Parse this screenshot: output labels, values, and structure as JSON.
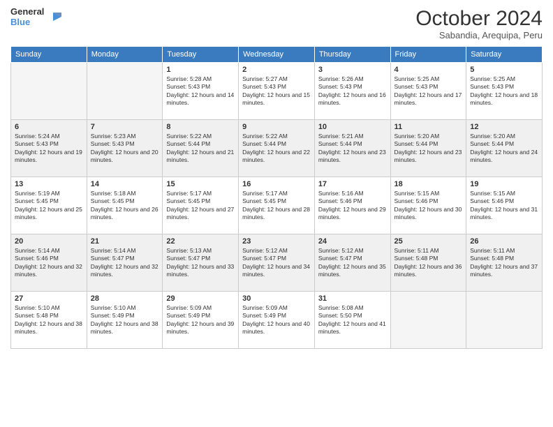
{
  "logo": {
    "line1": "General",
    "line2": "Blue"
  },
  "title": "October 2024",
  "location": "Sabandia, Arequipa, Peru",
  "days_of_week": [
    "Sunday",
    "Monday",
    "Tuesday",
    "Wednesday",
    "Thursday",
    "Friday",
    "Saturday"
  ],
  "weeks": [
    [
      {
        "day": "",
        "info": ""
      },
      {
        "day": "",
        "info": ""
      },
      {
        "day": "1",
        "info": "Sunrise: 5:28 AM\nSunset: 5:43 PM\nDaylight: 12 hours and 14 minutes."
      },
      {
        "day": "2",
        "info": "Sunrise: 5:27 AM\nSunset: 5:43 PM\nDaylight: 12 hours and 15 minutes."
      },
      {
        "day": "3",
        "info": "Sunrise: 5:26 AM\nSunset: 5:43 PM\nDaylight: 12 hours and 16 minutes."
      },
      {
        "day": "4",
        "info": "Sunrise: 5:25 AM\nSunset: 5:43 PM\nDaylight: 12 hours and 17 minutes."
      },
      {
        "day": "5",
        "info": "Sunrise: 5:25 AM\nSunset: 5:43 PM\nDaylight: 12 hours and 18 minutes."
      }
    ],
    [
      {
        "day": "6",
        "info": "Sunrise: 5:24 AM\nSunset: 5:43 PM\nDaylight: 12 hours and 19 minutes."
      },
      {
        "day": "7",
        "info": "Sunrise: 5:23 AM\nSunset: 5:43 PM\nDaylight: 12 hours and 20 minutes."
      },
      {
        "day": "8",
        "info": "Sunrise: 5:22 AM\nSunset: 5:44 PM\nDaylight: 12 hours and 21 minutes."
      },
      {
        "day": "9",
        "info": "Sunrise: 5:22 AM\nSunset: 5:44 PM\nDaylight: 12 hours and 22 minutes."
      },
      {
        "day": "10",
        "info": "Sunrise: 5:21 AM\nSunset: 5:44 PM\nDaylight: 12 hours and 23 minutes."
      },
      {
        "day": "11",
        "info": "Sunrise: 5:20 AM\nSunset: 5:44 PM\nDaylight: 12 hours and 23 minutes."
      },
      {
        "day": "12",
        "info": "Sunrise: 5:20 AM\nSunset: 5:44 PM\nDaylight: 12 hours and 24 minutes."
      }
    ],
    [
      {
        "day": "13",
        "info": "Sunrise: 5:19 AM\nSunset: 5:45 PM\nDaylight: 12 hours and 25 minutes."
      },
      {
        "day": "14",
        "info": "Sunrise: 5:18 AM\nSunset: 5:45 PM\nDaylight: 12 hours and 26 minutes."
      },
      {
        "day": "15",
        "info": "Sunrise: 5:17 AM\nSunset: 5:45 PM\nDaylight: 12 hours and 27 minutes."
      },
      {
        "day": "16",
        "info": "Sunrise: 5:17 AM\nSunset: 5:45 PM\nDaylight: 12 hours and 28 minutes."
      },
      {
        "day": "17",
        "info": "Sunrise: 5:16 AM\nSunset: 5:46 PM\nDaylight: 12 hours and 29 minutes."
      },
      {
        "day": "18",
        "info": "Sunrise: 5:15 AM\nSunset: 5:46 PM\nDaylight: 12 hours and 30 minutes."
      },
      {
        "day": "19",
        "info": "Sunrise: 5:15 AM\nSunset: 5:46 PM\nDaylight: 12 hours and 31 minutes."
      }
    ],
    [
      {
        "day": "20",
        "info": "Sunrise: 5:14 AM\nSunset: 5:46 PM\nDaylight: 12 hours and 32 minutes."
      },
      {
        "day": "21",
        "info": "Sunrise: 5:14 AM\nSunset: 5:47 PM\nDaylight: 12 hours and 32 minutes."
      },
      {
        "day": "22",
        "info": "Sunrise: 5:13 AM\nSunset: 5:47 PM\nDaylight: 12 hours and 33 minutes."
      },
      {
        "day": "23",
        "info": "Sunrise: 5:12 AM\nSunset: 5:47 PM\nDaylight: 12 hours and 34 minutes."
      },
      {
        "day": "24",
        "info": "Sunrise: 5:12 AM\nSunset: 5:47 PM\nDaylight: 12 hours and 35 minutes."
      },
      {
        "day": "25",
        "info": "Sunrise: 5:11 AM\nSunset: 5:48 PM\nDaylight: 12 hours and 36 minutes."
      },
      {
        "day": "26",
        "info": "Sunrise: 5:11 AM\nSunset: 5:48 PM\nDaylight: 12 hours and 37 minutes."
      }
    ],
    [
      {
        "day": "27",
        "info": "Sunrise: 5:10 AM\nSunset: 5:48 PM\nDaylight: 12 hours and 38 minutes."
      },
      {
        "day": "28",
        "info": "Sunrise: 5:10 AM\nSunset: 5:49 PM\nDaylight: 12 hours and 38 minutes."
      },
      {
        "day": "29",
        "info": "Sunrise: 5:09 AM\nSunset: 5:49 PM\nDaylight: 12 hours and 39 minutes."
      },
      {
        "day": "30",
        "info": "Sunrise: 5:09 AM\nSunset: 5:49 PM\nDaylight: 12 hours and 40 minutes."
      },
      {
        "day": "31",
        "info": "Sunrise: 5:08 AM\nSunset: 5:50 PM\nDaylight: 12 hours and 41 minutes."
      },
      {
        "day": "",
        "info": ""
      },
      {
        "day": "",
        "info": ""
      }
    ]
  ]
}
